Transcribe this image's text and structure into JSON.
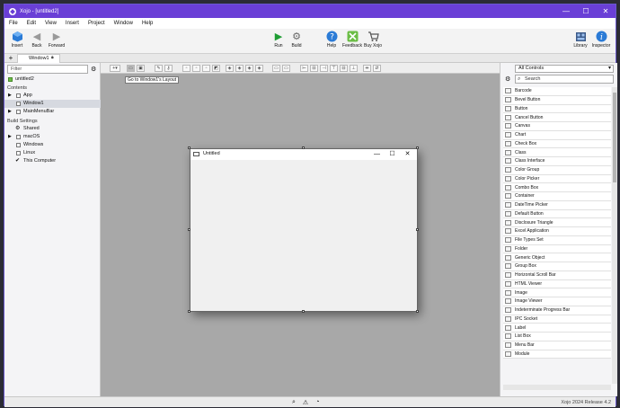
{
  "window": {
    "title": "Xojo - [untitled2]",
    "controls": [
      "—",
      "☐",
      "✕"
    ]
  },
  "menu": [
    "File",
    "Edit",
    "View",
    "Insert",
    "Project",
    "Window",
    "Help"
  ],
  "toolbar": {
    "insert": "Insert",
    "back": "Back",
    "forward": "Forward",
    "run": "Run",
    "build": "Build",
    "help": "Help",
    "feedback": "Feedback",
    "buy": "Buy Xojo",
    "library": "Library",
    "inspector": "Inspector"
  },
  "tabs": {
    "plus": "+",
    "active": "Window1"
  },
  "navigator": {
    "filter_placeholder": "Filter",
    "project": "untitled2",
    "contents_label": "Contents",
    "items": [
      {
        "label": "App",
        "expandable": true
      },
      {
        "label": "Window1",
        "expandable": false,
        "selected": true
      },
      {
        "label": "MainMenuBar",
        "expandable": true
      }
    ],
    "build_settings_label": "Build Settings",
    "build_items": [
      {
        "label": "Shared"
      },
      {
        "label": "macOS",
        "expandable": true
      },
      {
        "label": "Windows"
      },
      {
        "label": "Linux"
      },
      {
        "label": "This Computer",
        "checked": true
      }
    ]
  },
  "designer": {
    "tooltip": "Go to Window1's Layout",
    "window_title": "Untitled",
    "window_buttons": [
      "—",
      "☐",
      "✕"
    ]
  },
  "library": {
    "filter_select": "All Controls",
    "search_placeholder": "Search",
    "items": [
      "Barcode",
      "Bevel Button",
      "Button",
      "Cancel Button",
      "Canvas",
      "Chart",
      "Check Box",
      "Class",
      "Class Interface",
      "Color Group",
      "Color Picker",
      "Combo Box",
      "Container",
      "DateTime Picker",
      "Default Button",
      "Disclosure Triangle",
      "Excel Application",
      "File Types Set",
      "Folder",
      "Generic Object",
      "Group Box",
      "Horizontal Scroll Bar",
      "HTML Viewer",
      "Image",
      "Image Viewer",
      "Indeterminate Progress Bar",
      "IPC Socket",
      "Label",
      "List Box",
      "Menu Bar",
      "Module"
    ]
  },
  "status": {
    "version": "Xojo 2024 Release 4.2"
  }
}
